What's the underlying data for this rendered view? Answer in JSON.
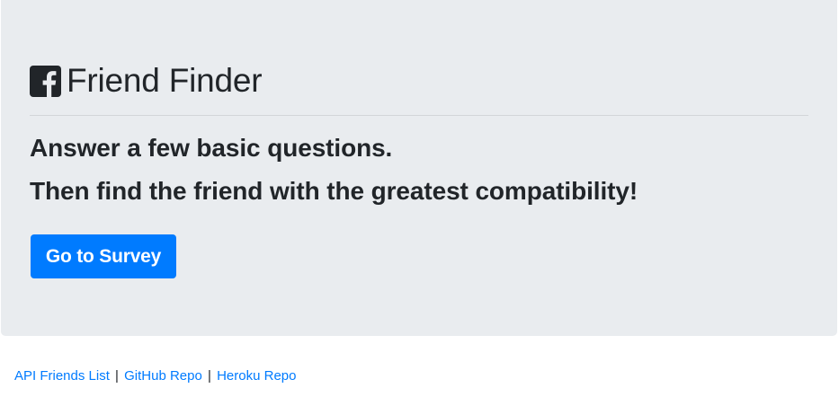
{
  "header": {
    "icon": "facebook-square-icon",
    "title": "Friend Finder"
  },
  "lead": {
    "line1": "Answer a few basic questions.",
    "line2": "Then find the friend with the greatest compatibility!"
  },
  "survey_button": {
    "label": "Go to Survey"
  },
  "footer": {
    "links": [
      {
        "label": "API Friends List"
      },
      {
        "label": "GitHub Repo"
      },
      {
        "label": "Heroku Repo"
      }
    ],
    "separator": "|"
  },
  "colors": {
    "jumbotron_bg": "#e9ecef",
    "primary": "#007bff",
    "text": "#212529"
  }
}
